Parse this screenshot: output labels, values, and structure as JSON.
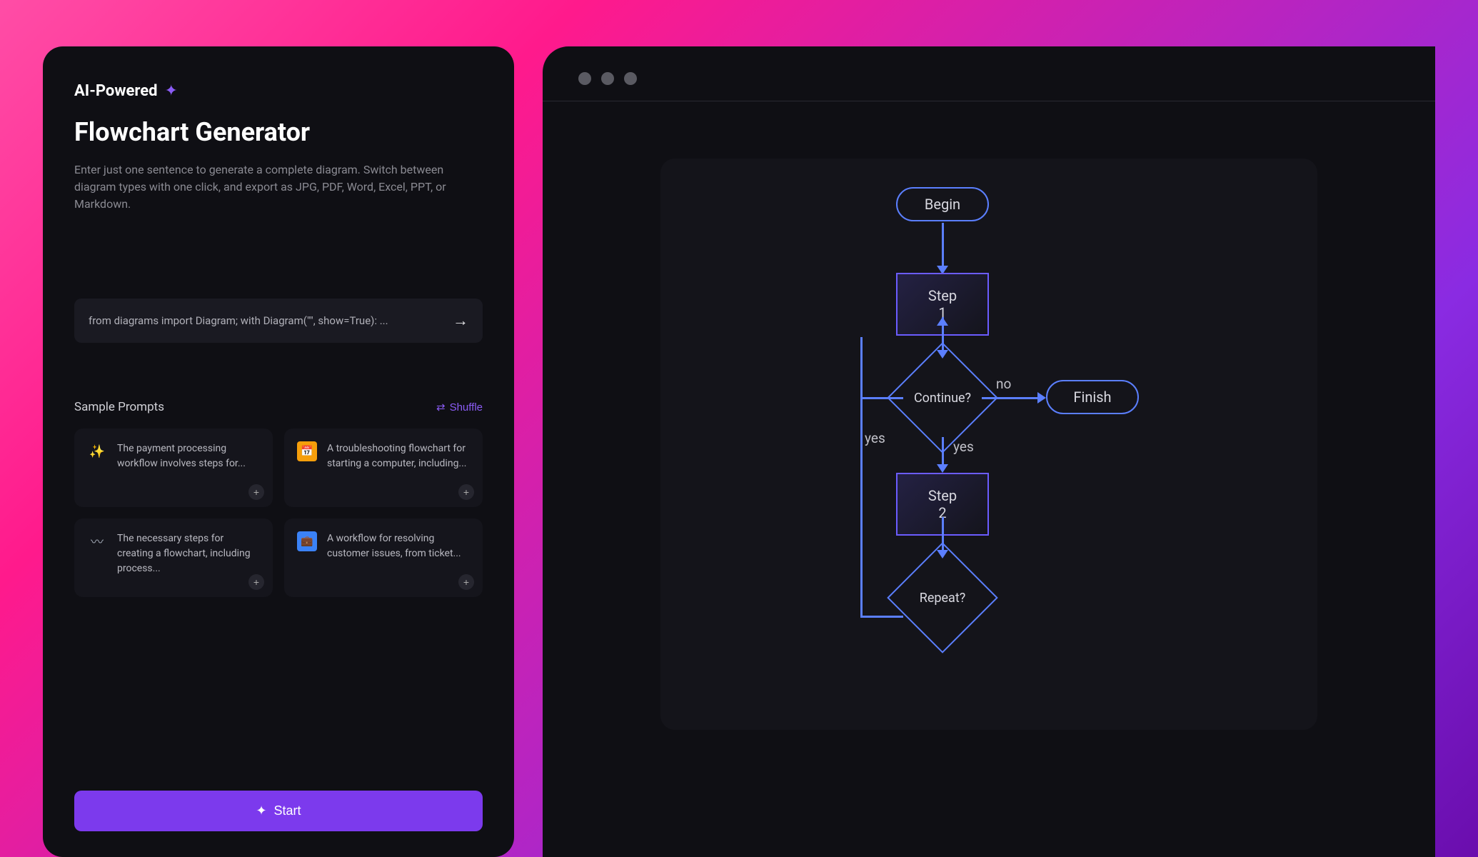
{
  "left": {
    "badge": "AI-Powered",
    "title": "Flowchart Generator",
    "description": "Enter just one sentence to generate a complete diagram. Switch between diagram types with one click, and export as JPG, PDF, Word, Excel, PPT, or Markdown.",
    "prompt_input": "from diagrams import Diagram; with Diagram(\"\", show=True): ...",
    "sample_label": "Sample Prompts",
    "shuffle_label": "Shuffle",
    "cards": [
      "The payment processing workflow involves steps for...",
      "A troubleshooting flowchart for starting a computer, including...",
      "The necessary steps for creating a flowchart, including process...",
      "A workflow for resolving customer issues, from ticket..."
    ],
    "start_label": "Start"
  },
  "flow": {
    "begin": "Begin",
    "step1": "Step 1",
    "continue": "Continue?",
    "finish": "Finish",
    "step2": "Step 2",
    "repeat": "Repeat?",
    "yes": "yes",
    "no": "no"
  }
}
